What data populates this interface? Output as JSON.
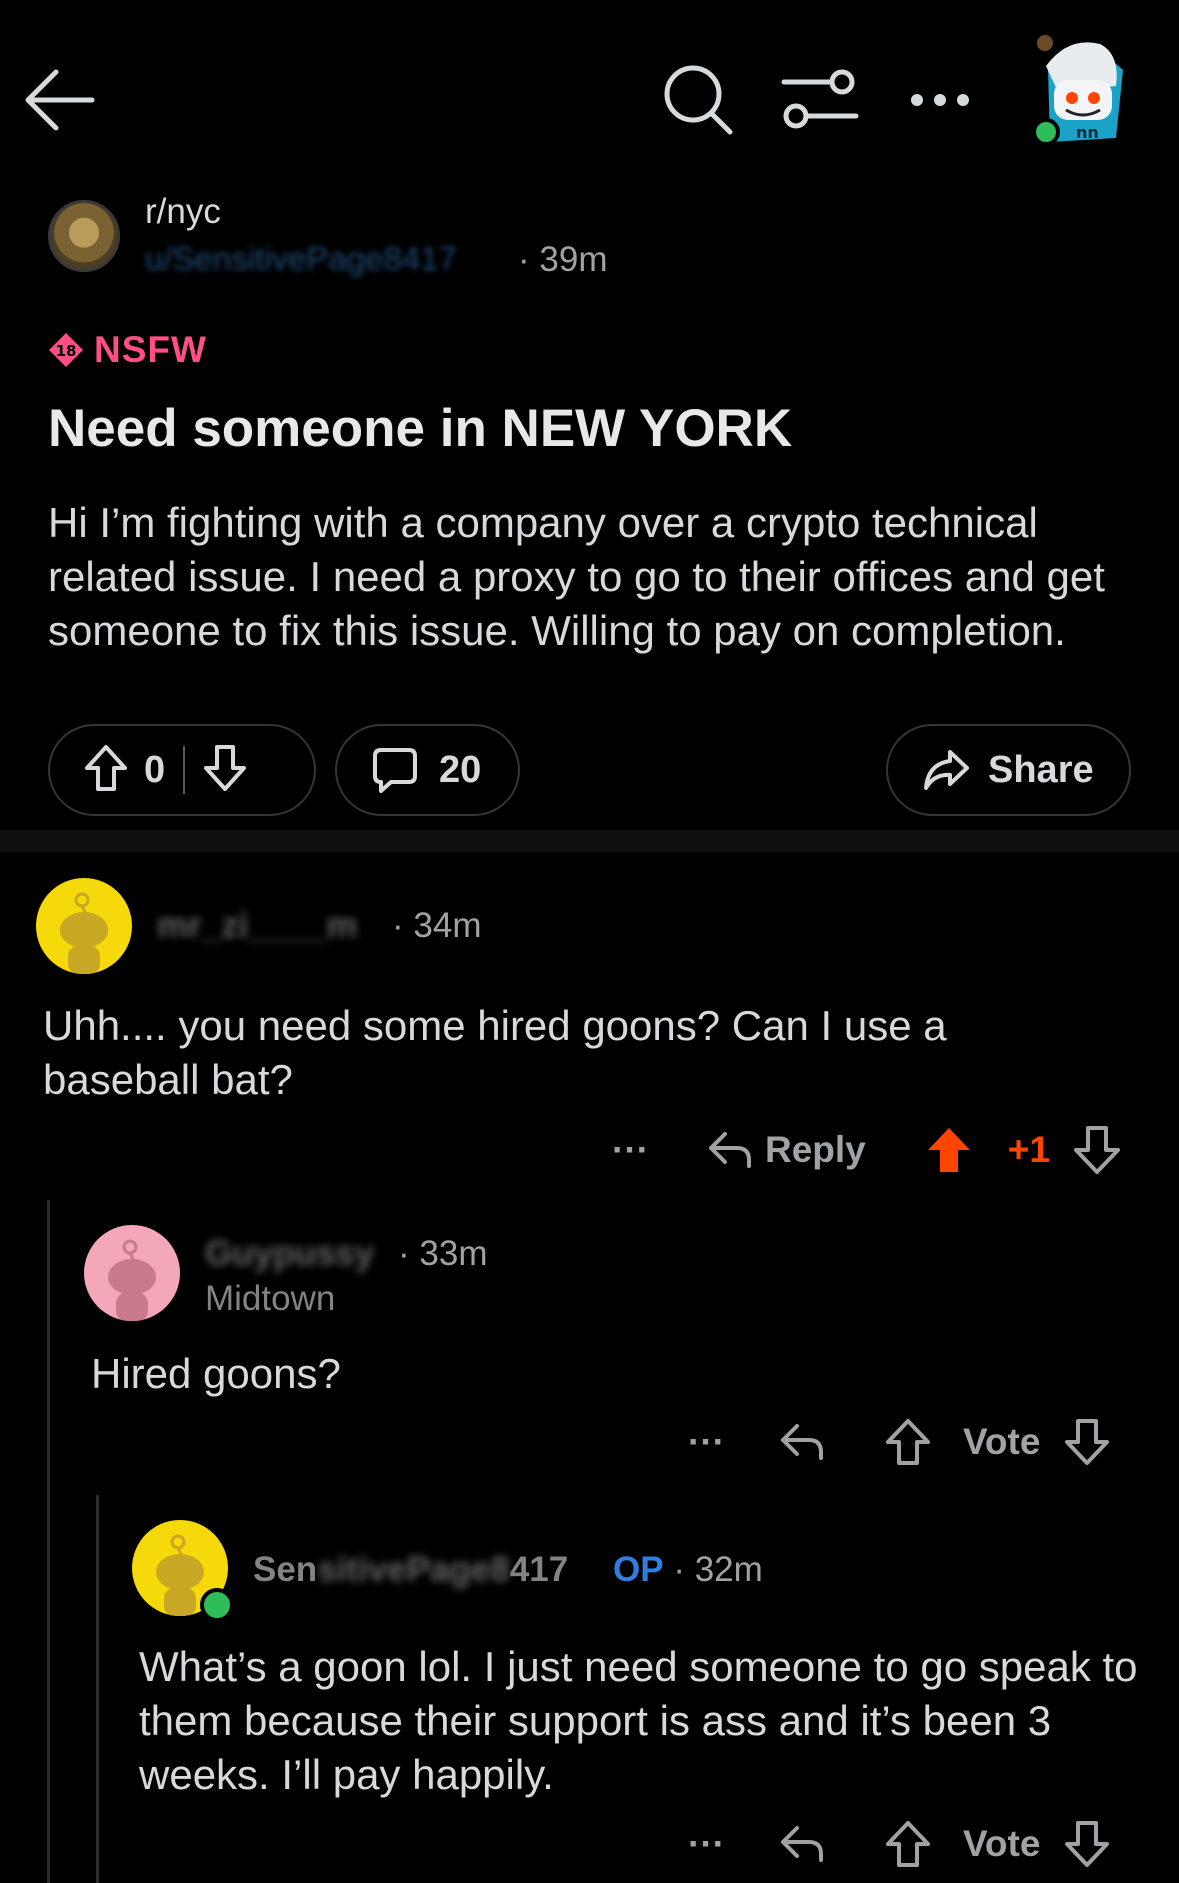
{
  "post": {
    "subreddit": "r/nyc",
    "author": "u/SensitivePage8417",
    "separator": "·",
    "time": "39m",
    "nsfw_badge_number": "18",
    "nsfw_label": "NSFW",
    "title": "Need someone in NEW YORK",
    "body": "Hi I’m fighting with a company over a crypto technical related issue. I need a proxy to go to their offices and get someone to fix this issue. Willing to pay on completion.",
    "vote_count": "0",
    "comment_count": "20",
    "share_label": "Share"
  },
  "comments": [
    {
      "author": "mr_zi____m",
      "separator": "·",
      "time": "34m",
      "body": "Uhh.... you need some hired goons? Can I use a baseball bat?",
      "more": "···",
      "reply_label": "Reply",
      "score": "+1",
      "upvoted": true,
      "avatar_color": "#f5d90a"
    },
    {
      "author": "Guypussy",
      "separator": "·",
      "time": "33m",
      "flair": "Midtown",
      "body": "Hired goons?",
      "more": "···",
      "vote_label": "Vote",
      "avatar_color": "#f4a7b9"
    },
    {
      "author_prefix": "Sen",
      "author_blurred": "sitivePage8",
      "author_suffix": "417",
      "op_label": "OP",
      "separator": "·",
      "time": "32m",
      "body": "What’s a goon lol. I just need someone to go speak to them because their support is ass and it’s been 3 weeks. I’ll pay happily.",
      "more": "···",
      "vote_label": "Vote",
      "avatar_color": "#f5d90a"
    }
  ],
  "colors": {
    "background": "#000000",
    "nsfw": "#ff4f84",
    "upvote": "#ff4500",
    "op": "#2e7fe0",
    "online": "#2ebd59"
  },
  "icons": [
    "back-arrow-icon",
    "search-icon",
    "filter-icon",
    "more-icon",
    "user-avatar-icon",
    "upvote-icon",
    "downvote-icon",
    "comment-icon",
    "share-icon",
    "reply-icon"
  ]
}
